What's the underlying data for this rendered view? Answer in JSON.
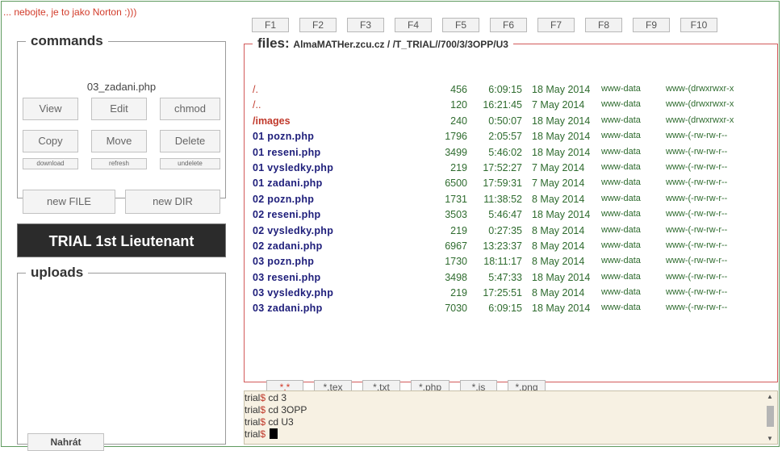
{
  "tagline": "... nebojte, je to jako Norton :)))",
  "fkeys": [
    "F1",
    "F2",
    "F3",
    "F4",
    "F5",
    "F6",
    "F7",
    "F8",
    "F9",
    "F10"
  ],
  "commands": {
    "title": "commands",
    "current_file": "03_zadani.php",
    "view": "View",
    "edit": "Edit",
    "chmod": "chmod",
    "copy": "Copy",
    "move": "Move",
    "delete": "Delete",
    "download": "download",
    "refresh": "refresh",
    "undelete": "undelete",
    "new_file": "new FILE",
    "new_dir": "new DIR"
  },
  "badge": "TRIAL 1st Lieutenant",
  "uploads": {
    "title": "uploads",
    "button": "Nahrát"
  },
  "files": {
    "title": "files:",
    "path": "AlmaMATHer.zcu.cz  /  /T_TRIAL//700/3/3OPP/U3",
    "rows": [
      {
        "name": "/.",
        "size": "456",
        "time": "6:09:15",
        "date": "18 May 2014",
        "owner": "www-data",
        "perm": "www-(drwxrwxr-x",
        "type": "dir"
      },
      {
        "name": "/..",
        "size": "120",
        "time": "16:21:45",
        "date": "7 May 2014",
        "owner": "www-data",
        "perm": "www-(drwxrwxr-x",
        "type": "dir"
      },
      {
        "name": "/images",
        "size": "240",
        "time": "0:50:07",
        "date": "18 May 2014",
        "owner": "www-data",
        "perm": "www-(drwxrwxr-x",
        "type": "dirbold"
      },
      {
        "name": "01  pozn.php",
        "size": "1796",
        "time": "2:05:57",
        "date": "18 May 2014",
        "owner": "www-data",
        "perm": "www-(-rw-rw-r--",
        "type": "file"
      },
      {
        "name": "01  reseni.php",
        "size": "3499",
        "time": "5:46:02",
        "date": "18 May 2014",
        "owner": "www-data",
        "perm": "www-(-rw-rw-r--",
        "type": "file"
      },
      {
        "name": "01  vysledky.php",
        "size": "219",
        "time": "17:52:27",
        "date": "7 May 2014",
        "owner": "www-data",
        "perm": "www-(-rw-rw-r--",
        "type": "file"
      },
      {
        "name": "01  zadani.php",
        "size": "6500",
        "time": "17:59:31",
        "date": "7 May 2014",
        "owner": "www-data",
        "perm": "www-(-rw-rw-r--",
        "type": "file"
      },
      {
        "name": "02  pozn.php",
        "size": "1731",
        "time": "11:38:52",
        "date": "8 May 2014",
        "owner": "www-data",
        "perm": "www-(-rw-rw-r--",
        "type": "file"
      },
      {
        "name": "02  reseni.php",
        "size": "3503",
        "time": "5:46:47",
        "date": "18 May 2014",
        "owner": "www-data",
        "perm": "www-(-rw-rw-r--",
        "type": "file"
      },
      {
        "name": "02  vysledky.php",
        "size": "219",
        "time": "0:27:35",
        "date": "8 May 2014",
        "owner": "www-data",
        "perm": "www-(-rw-rw-r--",
        "type": "file"
      },
      {
        "name": "02  zadani.php",
        "size": "6967",
        "time": "13:23:37",
        "date": "8 May 2014",
        "owner": "www-data",
        "perm": "www-(-rw-rw-r--",
        "type": "file"
      },
      {
        "name": "03  pozn.php",
        "size": "1730",
        "time": "18:11:17",
        "date": "8 May 2014",
        "owner": "www-data",
        "perm": "www-(-rw-rw-r--",
        "type": "file"
      },
      {
        "name": "03  reseni.php",
        "size": "3498",
        "time": "5:47:33",
        "date": "18 May 2014",
        "owner": "www-data",
        "perm": "www-(-rw-rw-r--",
        "type": "file"
      },
      {
        "name": "03  vysledky.php",
        "size": "219",
        "time": "17:25:51",
        "date": "8 May 2014",
        "owner": "www-data",
        "perm": "www-(-rw-rw-r--",
        "type": "file"
      },
      {
        "name": "03  zadani.php",
        "size": "7030",
        "time": "6:09:15",
        "date": "18 May 2014",
        "owner": "www-data",
        "perm": "www-(-rw-rw-r--",
        "type": "file"
      }
    ],
    "filters": [
      "*.*",
      "*.tex",
      "*.txt",
      "*.php",
      "*.js",
      "*.png"
    ],
    "active_filter": "*.*"
  },
  "terminal": {
    "prompt": "trial",
    "dollar": "$",
    "lines": [
      "cd 3",
      "cd 3OPP",
      "cd U3",
      ""
    ]
  },
  "colors": {
    "frame": "#5f9a5f",
    "files_border": "#d25a5a",
    "dir": "#c0392b",
    "file": "#1d1d7a",
    "meta": "#2e6b2e",
    "terminal_bg": "#f7f1e3"
  }
}
